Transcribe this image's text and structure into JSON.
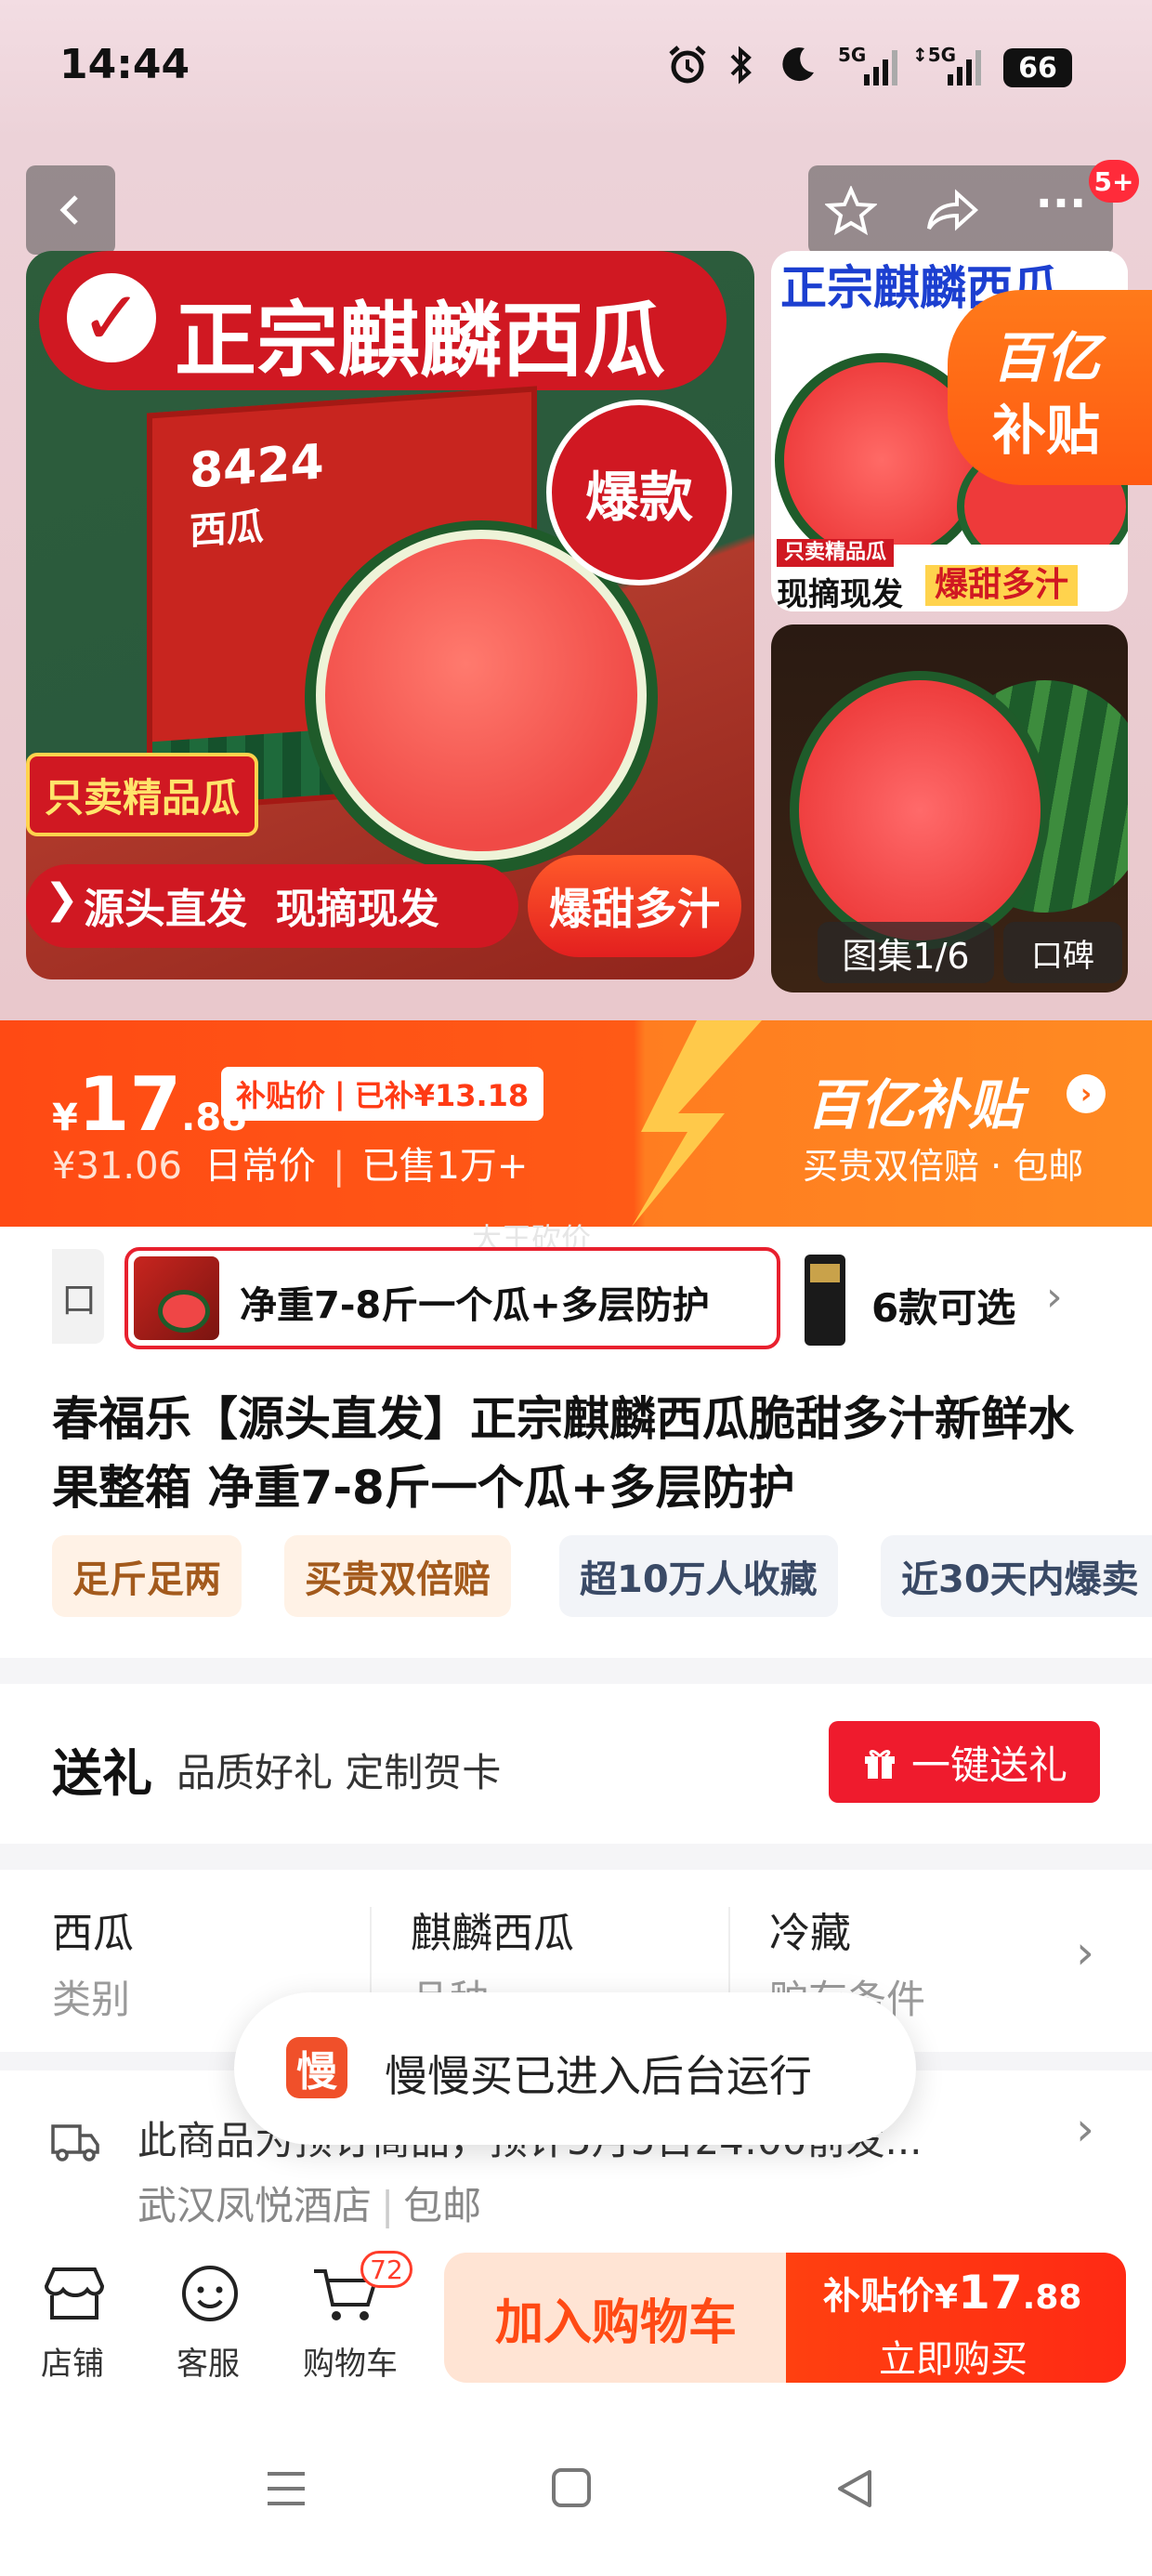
{
  "status_bar": {
    "time": "14:44",
    "network": "5G",
    "battery": "66"
  },
  "nav": {
    "cart_badge": "5+"
  },
  "main_image": {
    "banner": "正宗麒麟西瓜",
    "box_text": "8424",
    "box_text2": "西瓜",
    "badge": "爆款",
    "tag1": "只卖精品瓜",
    "bottom_left": "源头直发  现摘现发",
    "bottom_right": "爆甜多汁"
  },
  "thumbs": {
    "top_banner": "正宗麒麟西瓜",
    "subsidy_logo_1": "百亿",
    "subsidy_logo_2": "补贴",
    "tag1": "只卖精品瓜",
    "tag_line_a": "现摘现发",
    "tag_line_b": "爆甜多汁",
    "gallery": "图集1/6",
    "reviews": "口碑"
  },
  "price": {
    "currency": "¥",
    "integer": "17",
    "decimal": ".88",
    "label": "补贴价",
    "subsidy": "已补¥13.18",
    "original": "¥31.06",
    "original_label": "日常价",
    "sold": "已售1万+",
    "program_name": "百亿补贴",
    "program_sub": "买贵双倍赔 · 包邮"
  },
  "spec": {
    "left_fragment": "口",
    "selected": "净重7-8斤一个瓜+多层防护",
    "count": "6款可选",
    "watermark": "大王砍价"
  },
  "title": "春福乐【源头直发】正宗麒麟西瓜脆甜多汁新鲜水果整箱 净重7-8斤一个瓜+多层防护",
  "tags": [
    "足斤足两",
    "买贵双倍赔",
    "超10万人收藏",
    "近30天内爆卖"
  ],
  "gift": {
    "title": "送礼",
    "desc": "品质好礼 定制贺卡",
    "button": "一键送礼"
  },
  "attributes": [
    {
      "value": "西瓜",
      "key": "类别"
    },
    {
      "value": "麒麟西瓜",
      "key": "品种"
    },
    {
      "value": "冷藏",
      "key": "贮存条件"
    }
  ],
  "toast": {
    "icon_char": "慢",
    "text": "慢慢买已进入后台运行"
  },
  "shipping": {
    "line1": "此商品为预订商品，预计5月5日24:00前发...",
    "shop": "武汉凤悦酒店",
    "postage": "包邮"
  },
  "bottom_bar": {
    "shop": "店铺",
    "service": "客服",
    "cart": "购物车",
    "cart_count": "72",
    "add_to_cart": "加入购物车",
    "buy_price_label": "补贴价",
    "buy_price_currency": "¥",
    "buy_price_integer": "17",
    "buy_price_decimal": ".88",
    "buy_now": "立即购买"
  },
  "colors": {
    "accent": "#ff4a14",
    "buy": "#ff3c14",
    "gift": "#ef1b2d"
  }
}
